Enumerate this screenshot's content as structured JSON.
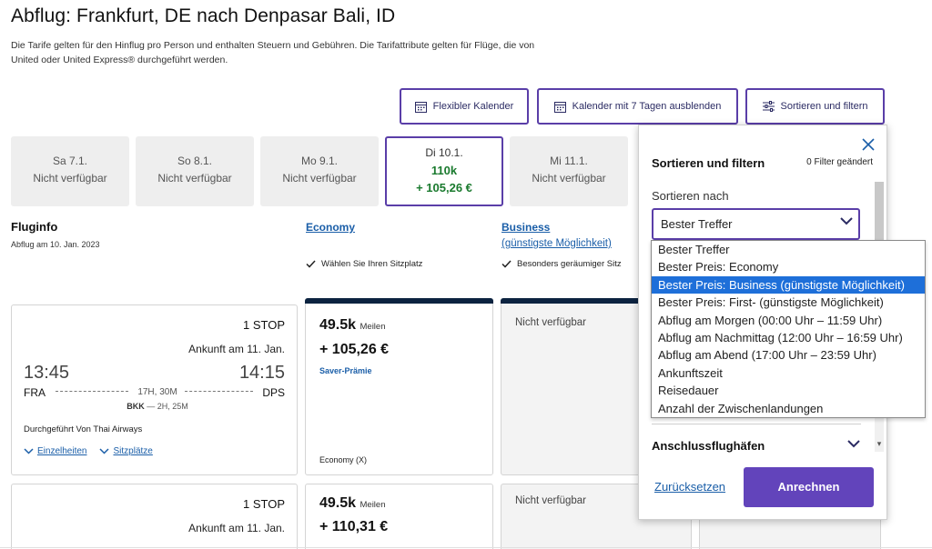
{
  "page": {
    "title": "Abflug: Frankfurt, DE nach Denpasar Bali, ID",
    "intro_line1": "Die Tarife gelten für den Hinflug pro Person und enthalten Steuern und Gebühren. Die Tarifattribute gelten für Flüge, die von",
    "intro_line2": "United oder United Express® durchgeführt werden."
  },
  "toolbar": {
    "flexible_calendar": "Flexibler Kalender",
    "hide_calendar": "Kalender mit 7 Tagen ausblenden",
    "sort_filter": "Sortieren und filtern"
  },
  "dates": [
    {
      "day": "Sa 7.1.",
      "status": "Nicht verfügbar"
    },
    {
      "day": "So 8.1.",
      "status": "Nicht verfügbar"
    },
    {
      "day": "Mo 9.1.",
      "status": "Nicht verfügbar"
    },
    {
      "day": "Di 10.1.",
      "miles": "110k",
      "price": "+ 105,26 €"
    },
    {
      "day": "Mi 11.1.",
      "status": "Nicht verfügbar"
    }
  ],
  "columns": {
    "fluginfo": "Fluginfo",
    "departure_date": "Abflug am 10. Jan. 2023",
    "economy": "Economy",
    "business": "Business",
    "business_sub": "(günstigste Möglichkeit)",
    "economy_feature": "Wählen Sie Ihren Sitzplatz",
    "business_feature": "Besonders geräumiger Sitz"
  },
  "flights": [
    {
      "stops": "1 STOP",
      "arrival": "Ankunft am 11. Jan.",
      "dep_time": "13:45",
      "arr_time": "14:15",
      "from": "FRA",
      "to": "DPS",
      "duration": "17H, 30M",
      "via_code": "BKK",
      "via_dur": "— 2H, 25M",
      "operator": "Durchgeführt Von Thai Airways",
      "details": "Einzelheiten",
      "seats": "Sitzplätze",
      "economy": {
        "miles": "49.5k",
        "miles_unit": "Meilen",
        "price": "+ 105,26 €",
        "type": "Saver-Prämie",
        "class": "Economy (X)"
      },
      "business": "Nicht verfügbar"
    },
    {
      "stops": "1 STOP",
      "arrival": "Ankunft am 11. Jan.",
      "economy": {
        "miles": "49.5k",
        "miles_unit": "Meilen",
        "price": "+ 110,31 €"
      },
      "business": "Nicht verfügbar"
    }
  ],
  "filter_panel": {
    "title": "Sortieren und filtern",
    "changed": "0 Filter geändert",
    "sort_label": "Sortieren nach",
    "selected": "Bester Treffer",
    "options": [
      "Bester Treffer",
      "Bester Preis: Economy",
      "Bester Preis: Business (günstigste Möglichkeit)",
      "Bester Preis: First- (günstigste Möglichkeit)",
      "Abflug am Morgen (00:00 Uhr – 11:59 Uhr)",
      "Abflug am Nachmittag (12:00 Uhr – 16:59 Uhr)",
      "Abflug am Abend (17:00 Uhr – 23:59 Uhr)",
      "Ankunftszeit",
      "Reisedauer",
      "Anzahl der Zwischenlandungen"
    ],
    "highlighted_index": 2,
    "connections": "Anschlussflughäfen",
    "reset": "Zurücksetzen",
    "apply": "Anrechnen"
  },
  "colors": {
    "accent": "#5a3ea8",
    "primary_button": "#6244bb",
    "link": "#1a5ea8",
    "price_green": "#1a7a2e",
    "navy": "#0c2340",
    "dropdown_highlight": "#1e6fd9"
  }
}
